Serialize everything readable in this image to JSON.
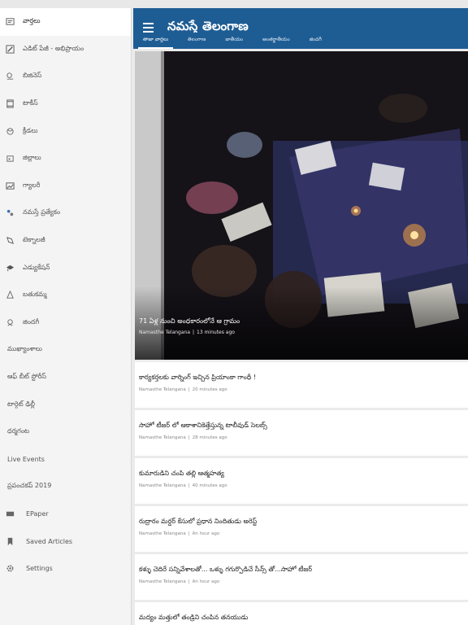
{
  "app": {
    "title": "నమస్తే తెలంగాణ"
  },
  "drawer": {
    "items": [
      {
        "label": "వార్తలు",
        "icon": "news-icon"
      },
      {
        "label": "ఎడిట్ పేజీ - అభిప్రాయం",
        "icon": "edit-icon"
      },
      {
        "label": "బిజినెస్",
        "icon": "business-icon"
      },
      {
        "label": "టాకీస్",
        "icon": "film-icon"
      },
      {
        "label": "క్రీడలు",
        "icon": "sports-icon"
      },
      {
        "label": "జిల్లాలు",
        "icon": "districts-icon"
      },
      {
        "label": "గ్యాలరీ",
        "icon": "gallery-icon"
      },
      {
        "label": "నమస్తే ప్రత్యేకం",
        "icon": "special-icon"
      },
      {
        "label": "టెక్నాలజీ",
        "icon": "technology-icon"
      },
      {
        "label": "ఎడ్యుకేషన్",
        "icon": "education-icon"
      },
      {
        "label": "బతుకమ్మ",
        "icon": "bathukamma-icon"
      },
      {
        "label": "జిందగీ",
        "icon": "zindagi-icon"
      },
      {
        "label": "ముఖ్యాంశాలు",
        "icon": ""
      },
      {
        "label": "ఆఫ్ బీట్ స్టోరీస్",
        "icon": ""
      },
      {
        "label": "టార్గెట్ ఢిల్లీ",
        "icon": ""
      },
      {
        "label": "ధర్మగంట",
        "icon": ""
      },
      {
        "label": "Live Events",
        "icon": ""
      },
      {
        "label": "ప్రపంచకప్ 2019",
        "icon": ""
      }
    ],
    "bottom": [
      {
        "label": "EPaper",
        "icon": "epaper-icon"
      },
      {
        "label": "Saved Articles",
        "icon": "bookmark-icon"
      },
      {
        "label": "Settings",
        "icon": "gear-icon"
      }
    ]
  },
  "tabs": [
    "తాజా వార్తలు",
    "తెలంగాణ",
    "జాతీయం",
    "అంతర్జాతీయం",
    "జిందగీ"
  ],
  "active_tab": 0,
  "hero": {
    "title": "71 ఏళ్ల నుంచి అంధకారంలోనే ఆ గ్రామం",
    "source": "Namasthe Telangana",
    "time": "13 minutes ago"
  },
  "articles": [
    {
      "title": "కార్యకర్తలకు వార్నింగ్ ఇచ్చిన ప్రియాంకా గాంధీ !",
      "source": "Namasthe Telangana",
      "time": "20 minutes ago"
    },
    {
      "title": "సాహో టీజర్ లో ఆకాశానికెత్తేస్తున్న టాలీవుడ్ సెలబ్స్",
      "source": "Namasthe Telangana",
      "time": "28 minutes ago"
    },
    {
      "title": "కుమారుడిని చంపి తల్లి ఆత్మహత్య",
      "source": "Namasthe Telangana",
      "time": "40 minutes ago"
    },
    {
      "title": "రుద్రారం మర్డర్ కేసులో ప్రధాన నిందితుడు అరెస్ట్",
      "source": "Namasthe Telangana",
      "time": "An hour ago"
    },
    {
      "title": "కళ్ళు చెదిరే సన్నివేశాలతో... ఒళ్ళు గగుర్పొడిచే సీన్స్ తో...సాహో టీజర్",
      "source": "Namasthe Telangana",
      "time": "An hour ago"
    },
    {
      "title": "మద్యం మత్తులో తండ్రిని చంపిన తనయుడు",
      "source": "",
      "time": ""
    }
  ],
  "colors": {
    "appbar": "#1e5d94",
    "drawer_bg": "#f4f4f4",
    "content_bg": "#ebebeb"
  }
}
